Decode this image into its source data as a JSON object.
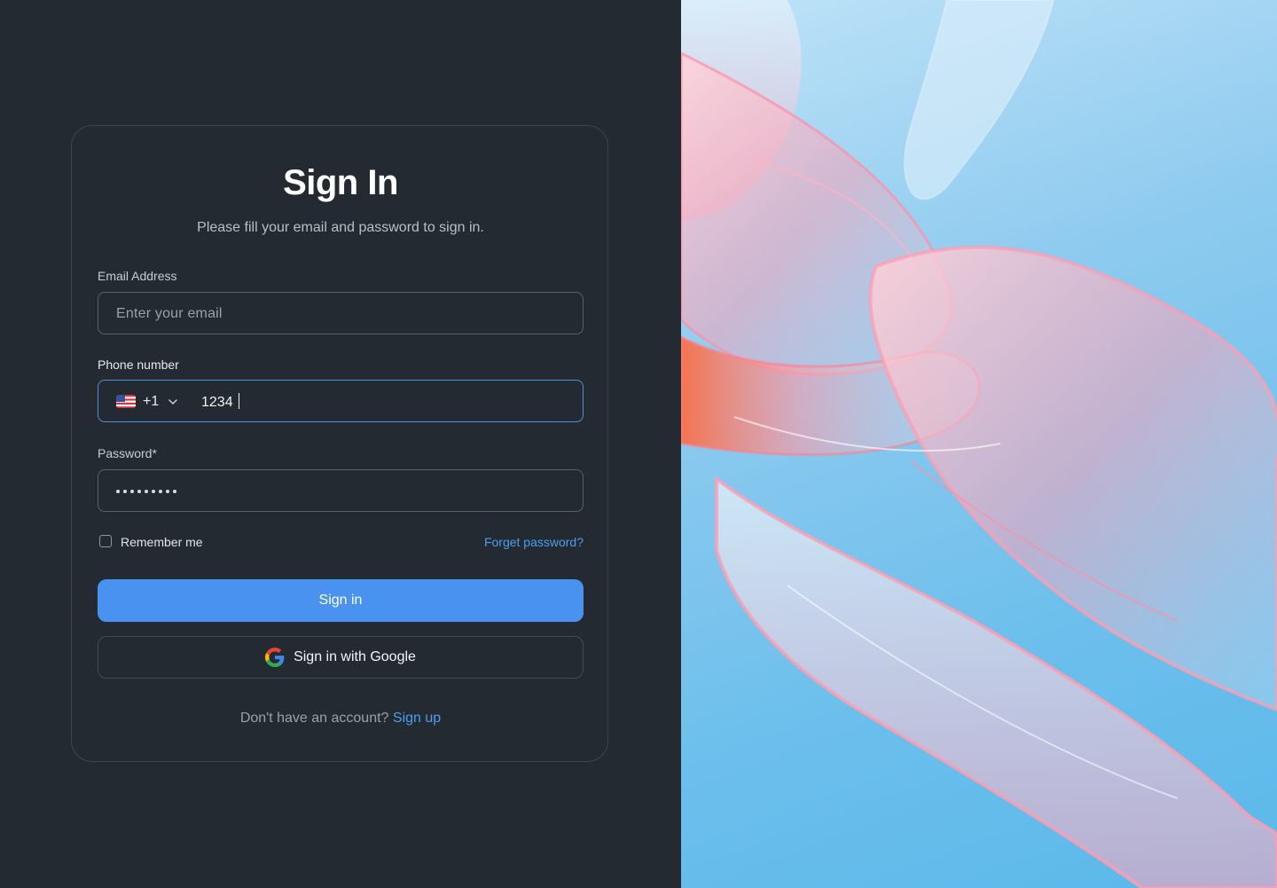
{
  "header": {
    "title": "Sign In",
    "subtitle": "Please fill your email and password to sign in."
  },
  "email": {
    "label": "Email Address",
    "placeholder": "Enter your email",
    "value": ""
  },
  "phone": {
    "label": "Phone number",
    "country_flag": "us-flag-icon",
    "dial_code": "+1",
    "value": "1234"
  },
  "password": {
    "label": "Password*",
    "masked_length": 9
  },
  "remember": {
    "label": "Remember me",
    "checked": false
  },
  "forget_link": "Forget password?",
  "sign_in_button": "Sign in",
  "google_button": "Sign in with Google",
  "footer": {
    "prompt": "Don't have an account?",
    "link": "Sign up"
  },
  "colors": {
    "background": "#242a31",
    "accent": "#4a92f0",
    "link": "#4b9ef0",
    "focus_border": "#4b8fe0"
  },
  "icons": [
    "us-flag-icon",
    "chevron-down-icon",
    "google-icon"
  ]
}
